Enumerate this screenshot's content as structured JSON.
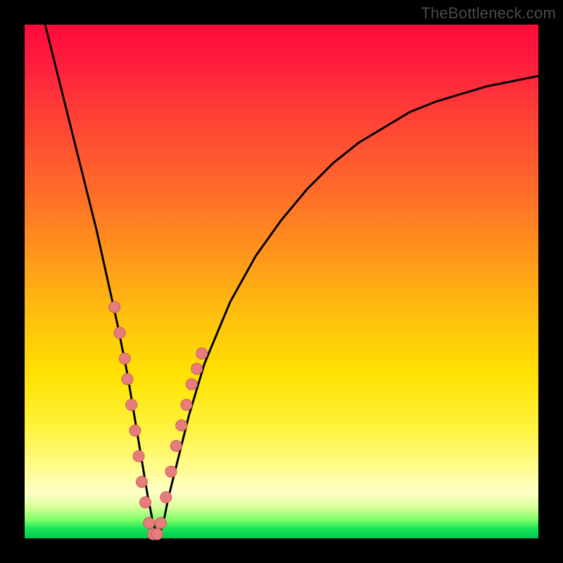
{
  "watermark": "TheBottleneck.com",
  "colors": {
    "frame": "#000000",
    "curve": "#000000",
    "marker_fill": "#e77c7c",
    "marker_stroke": "#c95f5f"
  },
  "chart_data": {
    "type": "line",
    "title": "",
    "xlabel": "",
    "ylabel": "",
    "xlim": [
      0,
      100
    ],
    "ylim": [
      0,
      100
    ],
    "grid": false,
    "legend": false,
    "note": "V-shaped bottleneck curve; y increases upward (higher = worse / more bottleneck). Values estimated from pixel positions; no axis ticks are shown in the image.",
    "series": [
      {
        "name": "bottleneck-curve",
        "x": [
          4,
          6,
          8,
          10,
          12,
          14,
          16,
          18,
          20,
          22,
          23,
          24,
          25,
          26,
          27,
          28,
          30,
          32,
          35,
          40,
          45,
          50,
          55,
          60,
          65,
          70,
          75,
          80,
          85,
          90,
          95,
          100
        ],
        "y": [
          100,
          92,
          84,
          76,
          68,
          60,
          51,
          42,
          32,
          20,
          14,
          8,
          3,
          0,
          3,
          8,
          16,
          24,
          34,
          46,
          55,
          62,
          68,
          73,
          77,
          80,
          83,
          85,
          86.5,
          88,
          89,
          90
        ]
      }
    ],
    "markers": {
      "name": "highlighted-points",
      "note": "Pink dots clustered around the valley on both branches.",
      "x": [
        17.5,
        18.5,
        19.5,
        20.0,
        20.8,
        21.5,
        22.2,
        22.8,
        23.5,
        24.2,
        25.0,
        25.8,
        26.5,
        27.5,
        28.5,
        29.5,
        30.5,
        31.5,
        32.5,
        33.5,
        34.5
      ],
      "y": [
        45,
        40,
        35,
        31,
        26,
        21,
        16,
        11,
        7,
        3,
        0.5,
        0.5,
        3,
        8,
        13,
        18,
        22,
        26,
        30,
        33,
        36
      ]
    }
  }
}
